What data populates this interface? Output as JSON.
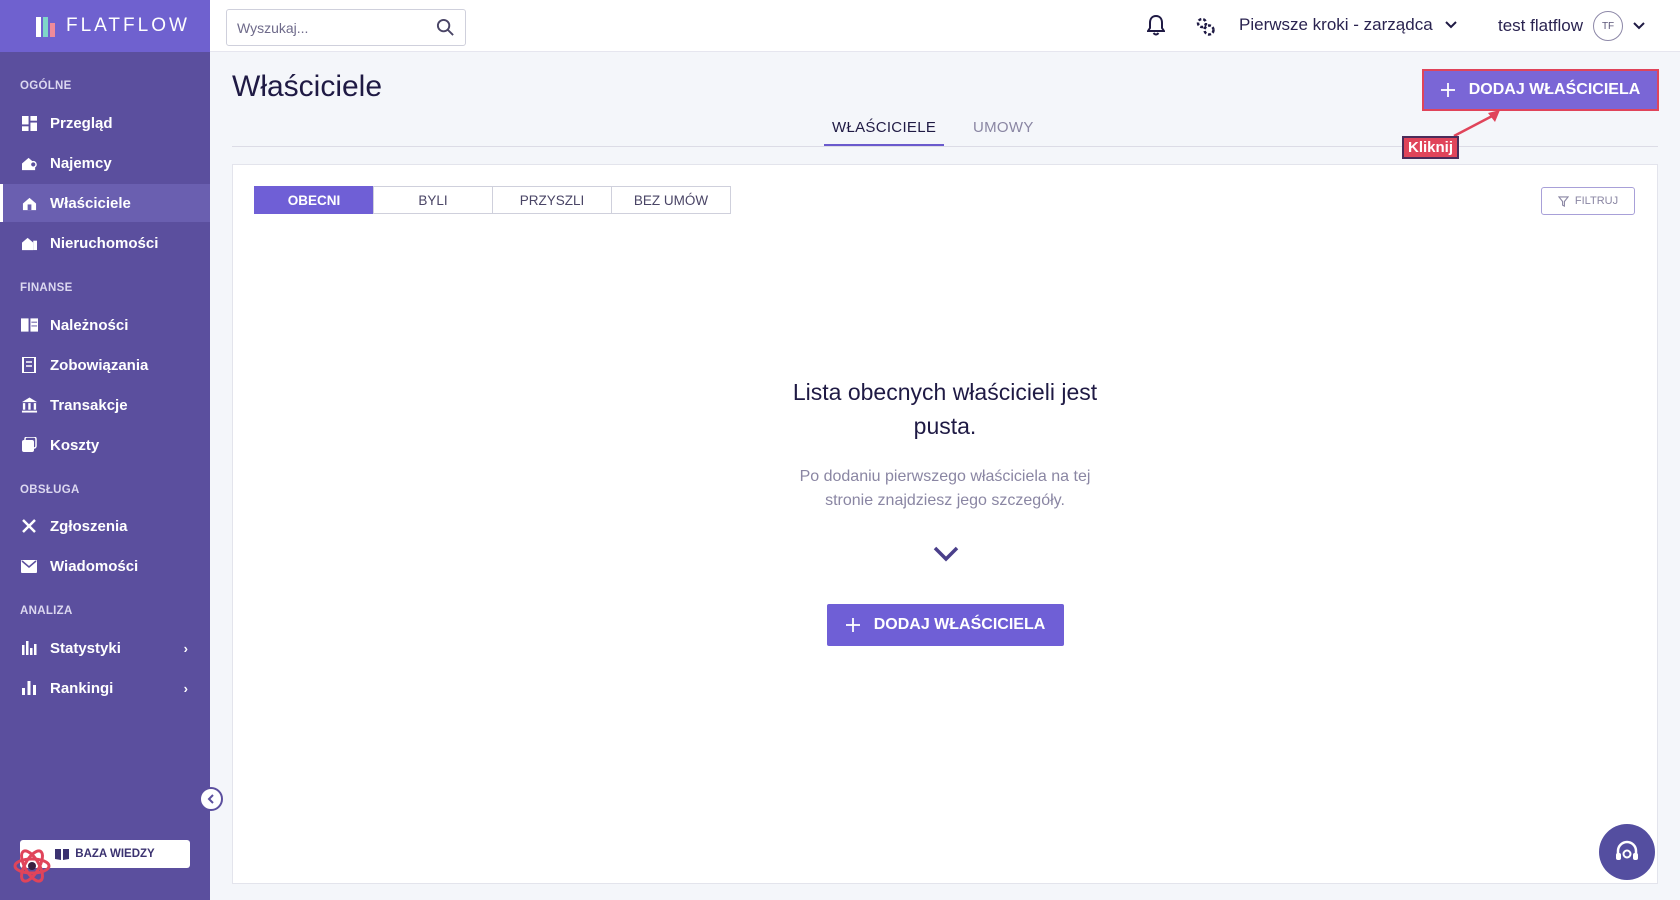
{
  "app": {
    "logo_text": "FLATFLOW"
  },
  "sidebar": {
    "sections": [
      {
        "label": "OGÓLNE"
      },
      {
        "label": "FINANSE"
      },
      {
        "label": "OBSŁUGA"
      },
      {
        "label": "ANALIZA"
      }
    ],
    "items": [
      {
        "label": "Przegląd",
        "icon": "dashboard-icon"
      },
      {
        "label": "Najemcy",
        "icon": "tenants-icon"
      },
      {
        "label": "Właściciele",
        "icon": "owners-icon",
        "active": true
      },
      {
        "label": "Nieruchomości",
        "icon": "buildings-icon"
      },
      {
        "label": "Należności",
        "icon": "receivables-icon"
      },
      {
        "label": "Zobowiązania",
        "icon": "liabilities-icon"
      },
      {
        "label": "Transakcje",
        "icon": "bank-icon"
      },
      {
        "label": "Koszty",
        "icon": "costs-icon"
      },
      {
        "label": "Zgłoszenia",
        "icon": "tools-icon"
      },
      {
        "label": "Wiadomości",
        "icon": "mail-icon"
      },
      {
        "label": "Statystyki",
        "icon": "stats-icon"
      },
      {
        "label": "Rankingi",
        "icon": "ranking-icon"
      }
    ],
    "knowledge_base": "BAZA WIEDZY"
  },
  "topbar": {
    "search_placeholder": "Wyszukaj...",
    "workspace": "Pierwsze kroki - zarządca",
    "user_name": "test flatflow",
    "avatar_initials": "TF"
  },
  "page": {
    "title": "Właściciele",
    "add_button": "DODAJ WŁAŚCICIELA",
    "tabs": [
      {
        "label": "WŁAŚCICIELE"
      },
      {
        "label": "UMOWY"
      }
    ],
    "annotation": "Kliknij"
  },
  "card": {
    "segments": [
      "OBECNI",
      "BYLI",
      "PRZYSZLI",
      "BEZ UMÓW"
    ],
    "filter": "FILTRUJ",
    "empty_title": "Lista obecnych właścicieli jest pusta.",
    "empty_sub": "Po dodaniu pierwszego właściciela na tej stronie znajdziesz jego szczegóły.",
    "add_button": "DODAJ WŁAŚCICIELA"
  },
  "colors": {
    "sidebar": "#5b4f9e",
    "accent": "#6f5fd6",
    "highlight": "#e0445a"
  }
}
